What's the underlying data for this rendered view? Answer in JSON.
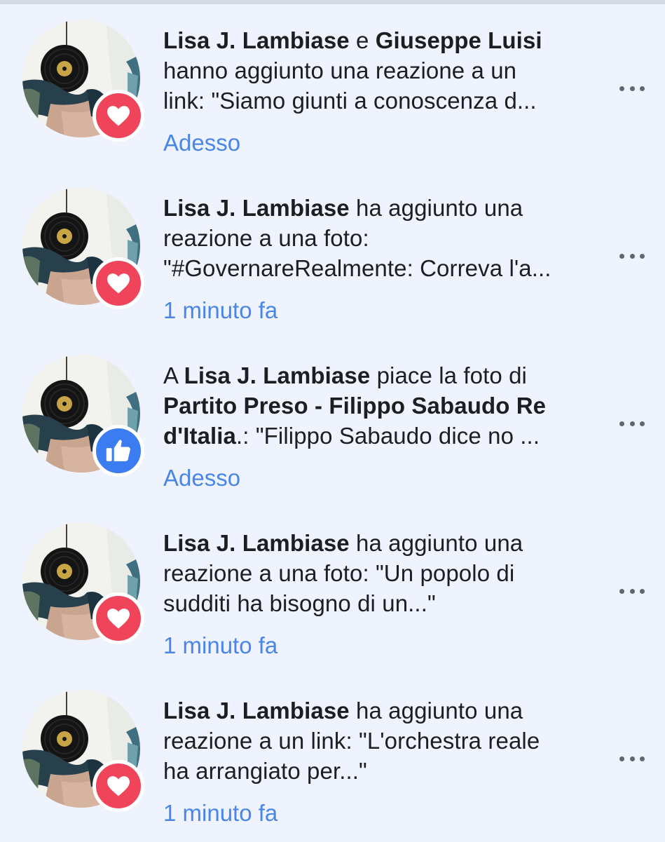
{
  "notifications": [
    {
      "reaction": "heart-icon",
      "lines": [
        [
          {
            "t": "Lisa J. Lambiase",
            "b": true
          },
          {
            "t": " e "
          },
          {
            "t": "Giuseppe Luisi",
            "b": true
          }
        ],
        [
          {
            "t": "hanno aggiunto una reazione a un"
          }
        ],
        [
          {
            "t": "link: \"Siamo giunti a conoscenza d..."
          }
        ]
      ],
      "time": "Adesso"
    },
    {
      "reaction": "heart-icon",
      "lines": [
        [
          {
            "t": "Lisa J. Lambiase",
            "b": true
          },
          {
            "t": " ha aggiunto una"
          }
        ],
        [
          {
            "t": "reazione a una foto:"
          }
        ],
        [
          {
            "t": "\"#GovernareRealmente: Correva l'a..."
          }
        ]
      ],
      "time": "1 minuto fa"
    },
    {
      "reaction": "thumbs-up-icon",
      "lines": [
        [
          {
            "t": "A "
          },
          {
            "t": "Lisa J. Lambiase",
            "b": true
          },
          {
            "t": " piace la foto di"
          }
        ],
        [
          {
            "t": "Partito Preso - Filippo Sabaudo Re",
            "b": true
          }
        ],
        [
          {
            "t": "d'Italia",
            "b": true
          },
          {
            "t": ".: \"Filippo Sabaudo dice no ..."
          }
        ]
      ],
      "time": "Adesso"
    },
    {
      "reaction": "heart-icon",
      "lines": [
        [
          {
            "t": "Lisa J. Lambiase",
            "b": true
          },
          {
            "t": " ha aggiunto una"
          }
        ],
        [
          {
            "t": "reazione a una foto: \"Un popolo di"
          }
        ],
        [
          {
            "t": "sudditi ha bisogno di un...\""
          }
        ]
      ],
      "time": "1 minuto fa"
    },
    {
      "reaction": "heart-icon",
      "lines": [
        [
          {
            "t": "Lisa J. Lambiase",
            "b": true
          },
          {
            "t": " ha aggiunto una"
          }
        ],
        [
          {
            "t": "reazione a un link: \"L'orchestra reale"
          }
        ],
        [
          {
            "t": "ha arrangiato per...\""
          }
        ]
      ],
      "time": "1 minuto fa"
    }
  ],
  "colors": {
    "background": "#eef3fd",
    "love": "#f0445a",
    "like": "#3b7cf0",
    "timestamp": "#4a86e8",
    "text": "#1c1e21"
  }
}
